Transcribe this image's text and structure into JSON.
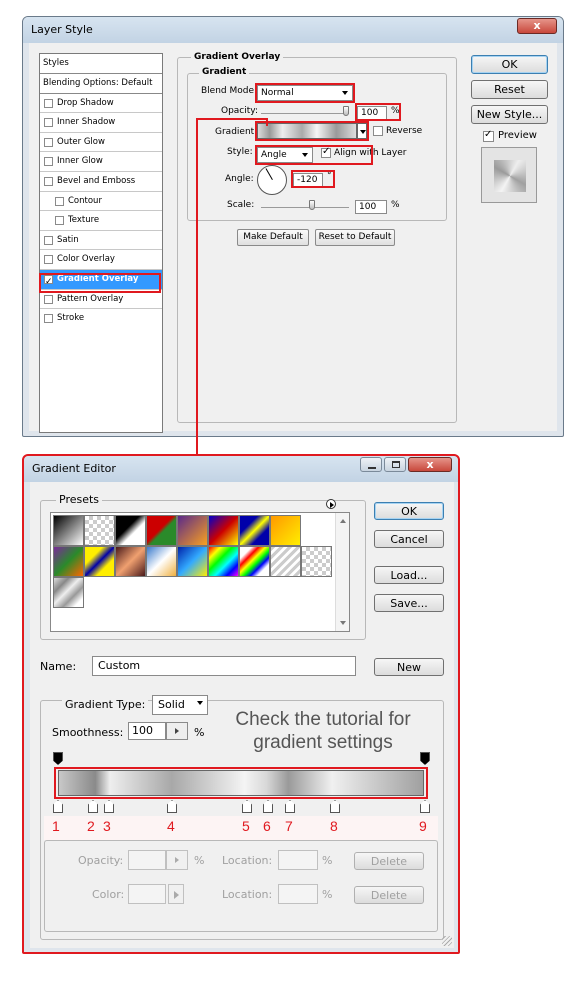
{
  "layer_style": {
    "title": "Layer Style",
    "close": "x",
    "styles_items": [
      "Styles",
      "Blending Options: Default",
      "Drop Shadow",
      "Inner Shadow",
      "Outer Glow",
      "Inner Glow",
      "Bevel and Emboss",
      "Contour",
      "Texture",
      "Satin",
      "Color Overlay",
      "Gradient Overlay",
      "Pattern Overlay",
      "Stroke"
    ],
    "section": "Gradient Overlay",
    "group": "Gradient",
    "blend_mode_label": "Blend Mode:",
    "blend_mode": "Normal",
    "opacity_label": "Opacity:",
    "opacity": "100",
    "pct": "%",
    "gradient_label": "Gradient:",
    "reverse": "Reverse",
    "style_label": "Style:",
    "style": "Angle",
    "align": "Align with Layer",
    "angle_label": "Angle:",
    "angle": "-120",
    "degree": "°",
    "scale_label": "Scale:",
    "scale": "100",
    "make_default": "Make Default",
    "reset_default": "Reset to Default",
    "ok": "OK",
    "reset": "Reset",
    "new_style": "New Style...",
    "preview": "Preview"
  },
  "gradient_editor": {
    "title": "Gradient Editor",
    "presets_label": "Presets",
    "ok": "OK",
    "cancel": "Cancel",
    "load": "Load...",
    "save": "Save...",
    "name_label": "Name:",
    "name": "Custom",
    "new": "New",
    "type_label": "Gradient Type:",
    "type": "Solid",
    "smoothness_label": "Smoothness:",
    "smoothness": "100",
    "pct": "%",
    "tutorial_note": "Check the tutorial for gradient settings",
    "stop_numbers": [
      "1",
      "2",
      "3",
      "4",
      "5",
      "6",
      "7",
      "8",
      "9"
    ],
    "opacity_label": "Opacity:",
    "location_label": "Location:",
    "color_label": "Color:",
    "delete": "Delete"
  }
}
